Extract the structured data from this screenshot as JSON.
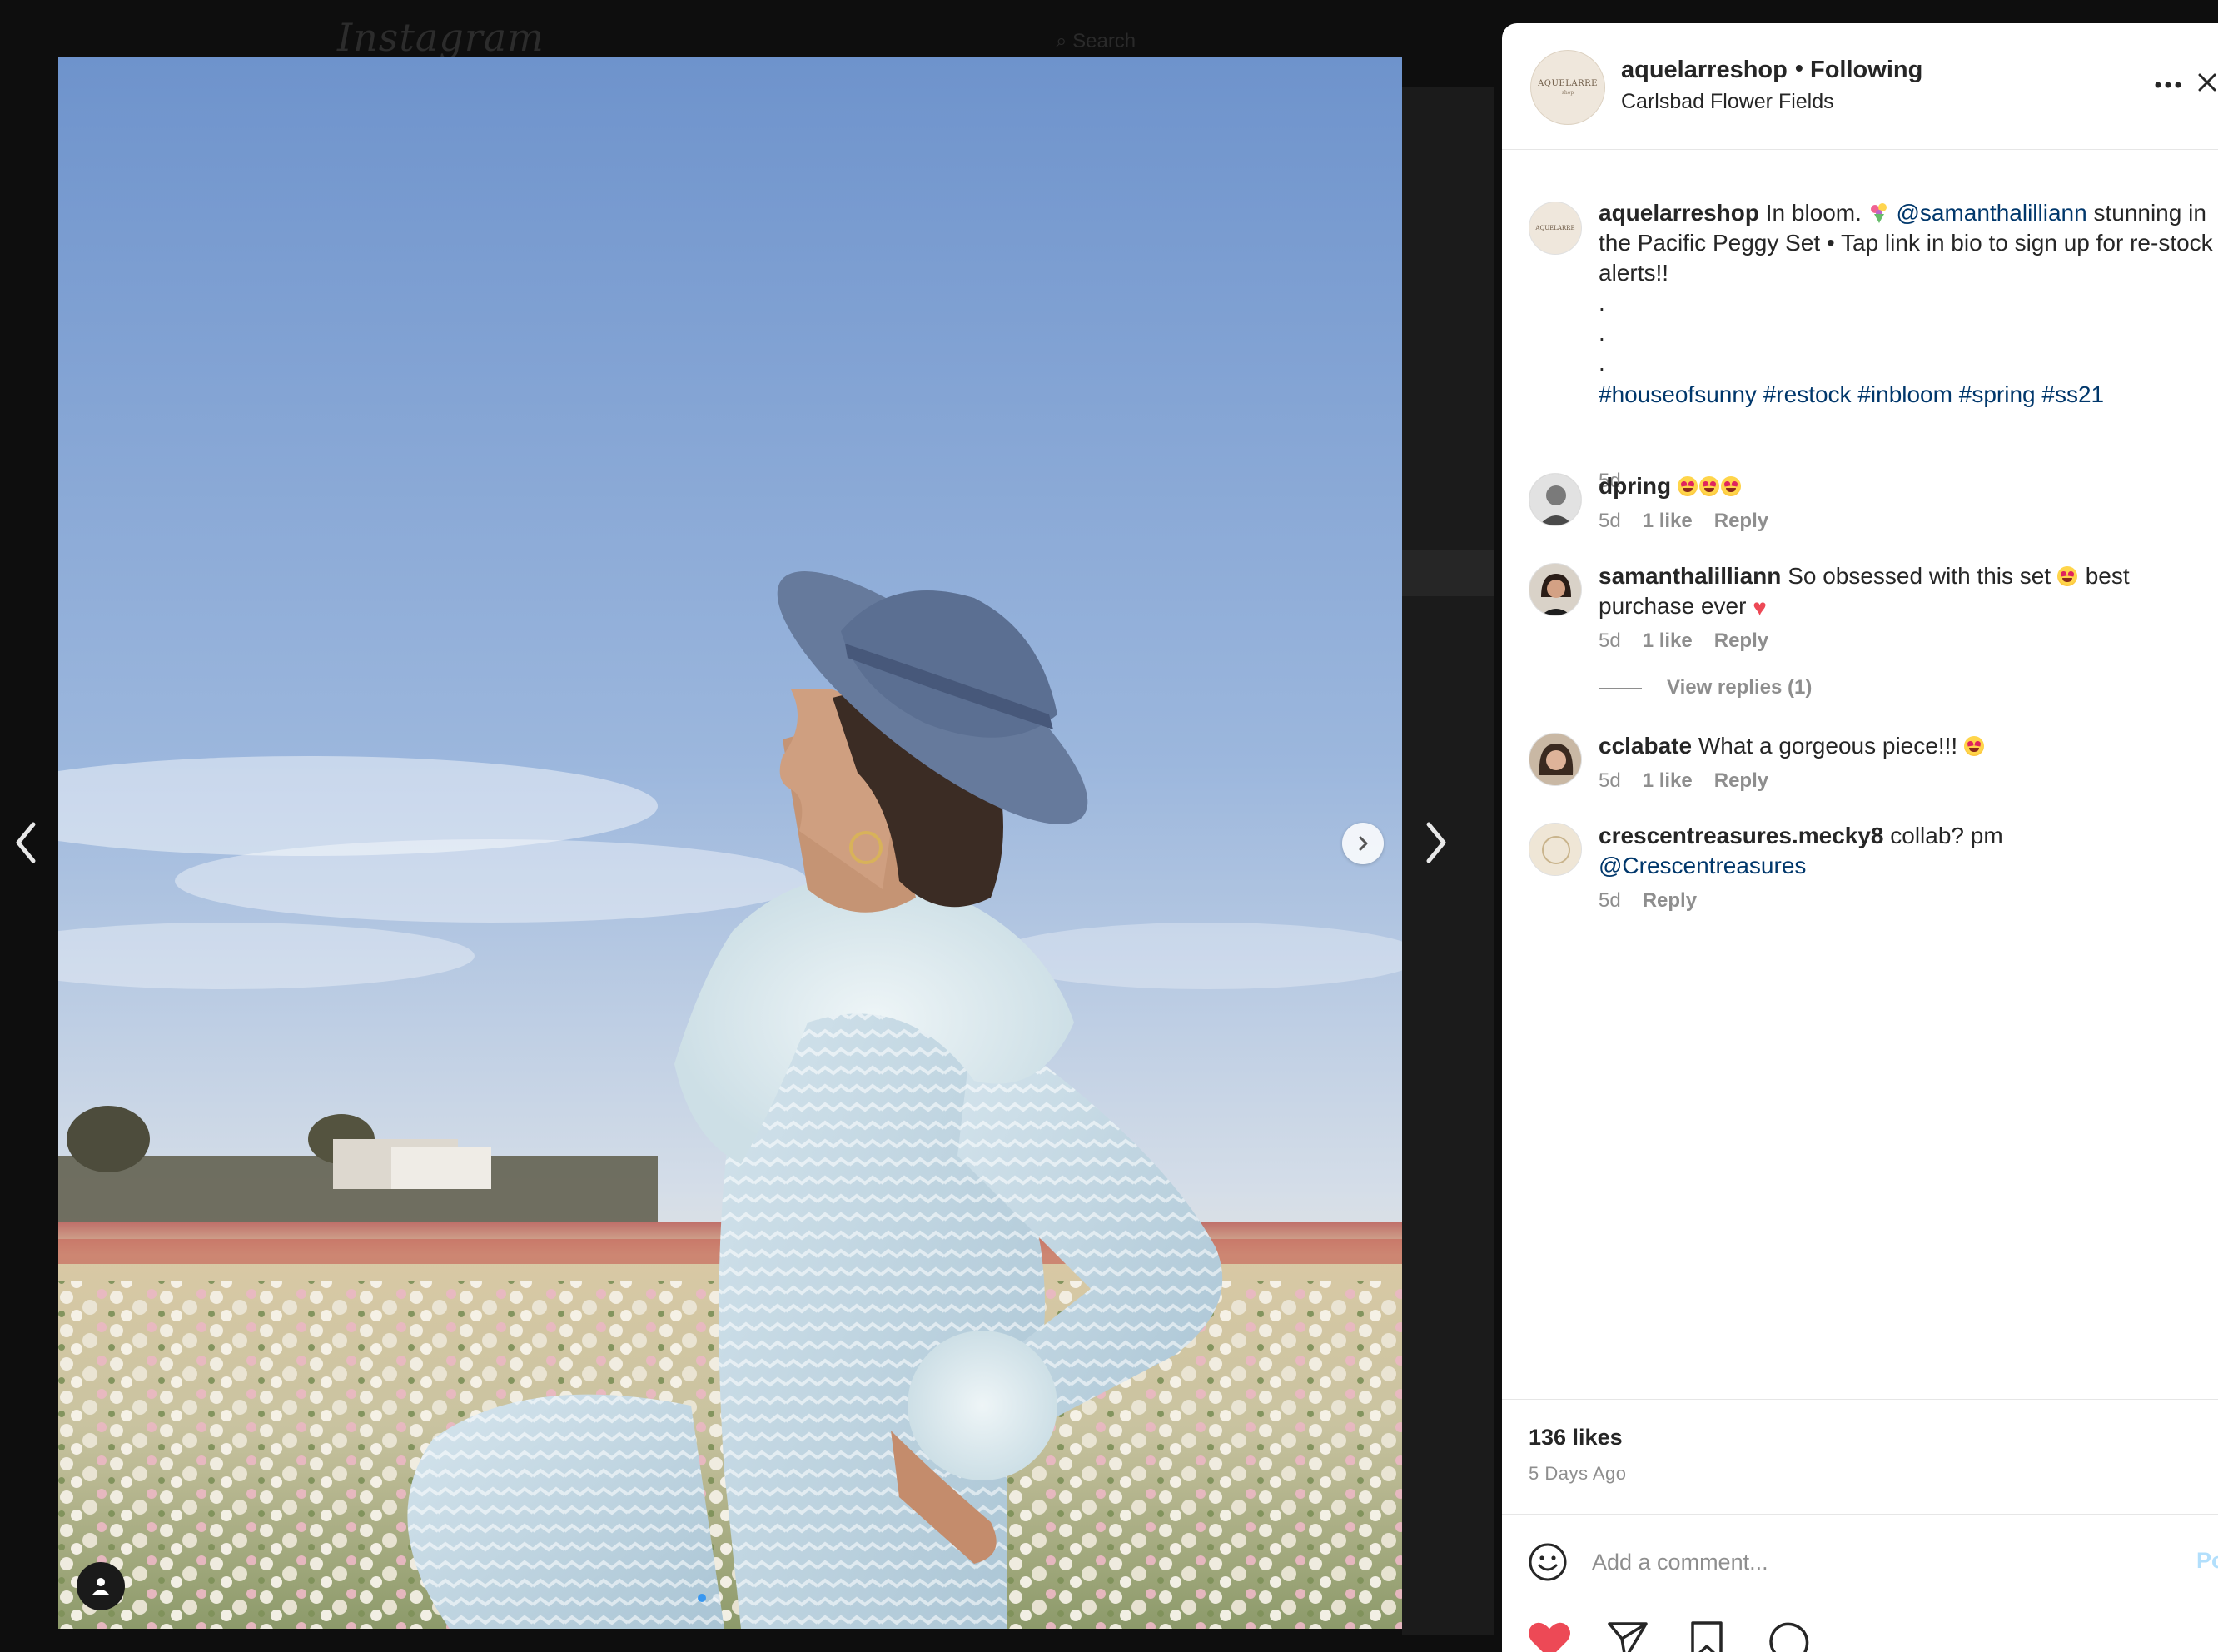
{
  "background": {
    "logo": "Instagram",
    "search_placeholder": "Search"
  },
  "post_header": {
    "username": "aquelarreshop",
    "separator": "•",
    "follow_status": "Following",
    "location": "Carlsbad Flower Fields",
    "avatar_brand": "AQUELARRE",
    "avatar_sub": "shop"
  },
  "caption": {
    "username": "aquelarreshop",
    "text_1": "In bloom.",
    "mention": "@samanthalilliann",
    "text_2": "stunning in the Pacific Peggy Set • Tap link in bio to sign up for re-stock alerts!!",
    "dots": [
      ".",
      ".",
      "."
    ],
    "hashtags": [
      "#houseofsunny",
      "#restock",
      "#inbloom",
      "#spring",
      "#ss21"
    ],
    "time": "5d"
  },
  "comments": [
    {
      "username": "dpring",
      "text": "",
      "time": "5d",
      "likes": "1 like",
      "reply": "Reply"
    },
    {
      "username": "samanthalilliann",
      "text_1": "So obsessed with this set",
      "text_2": "best purchase ever",
      "time": "5d",
      "likes": "1 like",
      "reply": "Reply"
    },
    {
      "username": "cclabate",
      "text": "What a gorgeous piece!!!",
      "time": "5d",
      "likes": "1 like",
      "reply": "Reply"
    },
    {
      "username": "crescentreasures.mecky8",
      "text": "collab? pm",
      "mention": "@Crescentreasures",
      "time": "5d",
      "reply": "Reply"
    }
  ],
  "view_replies": "View replies (1)",
  "likes": "136 likes",
  "posted_ago": "5 Days Ago",
  "comment_box": {
    "placeholder": "Add a comment...",
    "post_label": "Post"
  },
  "colors": {
    "like_heart": "#ed4956",
    "link": "#00376b",
    "muted": "#8e8e8e",
    "text": "#262626",
    "post_button": "#b2dffc"
  },
  "icons": [
    "chevron-left-icon",
    "chevron-right-icon",
    "more-icon",
    "close-icon",
    "user-tag-icon",
    "smile-icon",
    "heart-icon",
    "send-icon",
    "bookmark-icon",
    "comment-icon"
  ]
}
